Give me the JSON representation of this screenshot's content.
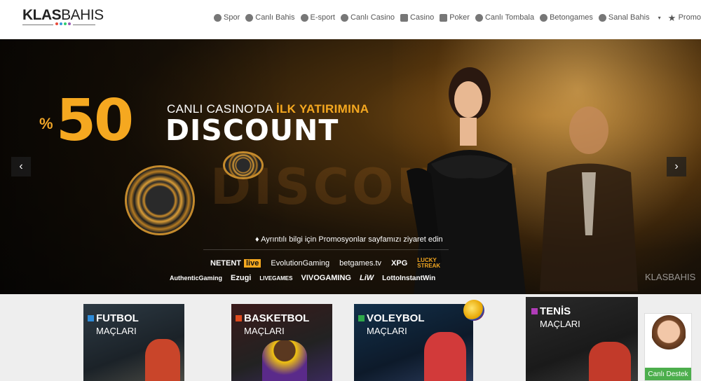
{
  "brand": {
    "logo_bold": "KLAS",
    "logo_light": "BAHIS",
    "dot_colors": [
      "#e74c3c",
      "#3498db",
      "#2ecc71",
      "#9b59b6"
    ]
  },
  "nav": {
    "items": [
      {
        "label": "Spor",
        "icon": "soccer-ball-icon"
      },
      {
        "label": "Canlı Bahis",
        "icon": "live-ball-icon"
      },
      {
        "label": "E-sport",
        "icon": "esport-icon"
      },
      {
        "label": "Canlı Casino",
        "icon": "casino-chip-icon"
      },
      {
        "label": "Casino",
        "icon": "gamepad-icon"
      },
      {
        "label": "Poker",
        "icon": "cards-icon"
      },
      {
        "label": "Canlı Tombala",
        "icon": "tombala-icon"
      },
      {
        "label": "Betongames",
        "icon": "dice-icon"
      },
      {
        "label": "Sanal Bahis",
        "icon": "virtual-icon"
      }
    ],
    "more_caret": "▾",
    "promotions": {
      "label": "Promosyonlar",
      "icon": "star-icon"
    }
  },
  "hero": {
    "percent_sign": "%",
    "big_number": "50",
    "line1_plain": "CANLI CASINO’DA ",
    "line1_highlight": "İLK YATIRIMINA",
    "line2": "DISCOUNT",
    "watermark": "DISCOUNT",
    "info": "Ayrıntılı bilgi için Promosyonlar sayfamızı ziyaret edin",
    "providers_row1": [
      "NETENT",
      "live",
      "EvolutionGaming",
      "betgames.tv",
      "XPG",
      "LUCKY STREAK"
    ],
    "providers_row2": [
      "AuthenticGaming",
      "Ezugi",
      "LIVEGAMES",
      "VIVOGAMING",
      "LiW",
      "LottoInstantWin"
    ],
    "corner_logo": "KLASBAHIS",
    "prev_arrow": "‹",
    "next_arrow": "›"
  },
  "cards": [
    {
      "title": "FUTBOL",
      "sub": "MAÇLARI",
      "accent": "#2e8bd8"
    },
    {
      "title": "BASKETBOL",
      "sub": "MAÇLARI",
      "accent": "#e04a1e"
    },
    {
      "title": "VOLEYBOL",
      "sub": "MAÇLARI",
      "accent": "#2ea84a"
    },
    {
      "title": "TENİS",
      "sub": "MAÇLARI",
      "accent": "#b03cb8"
    }
  ],
  "support": {
    "label": "Canlı Destek"
  }
}
